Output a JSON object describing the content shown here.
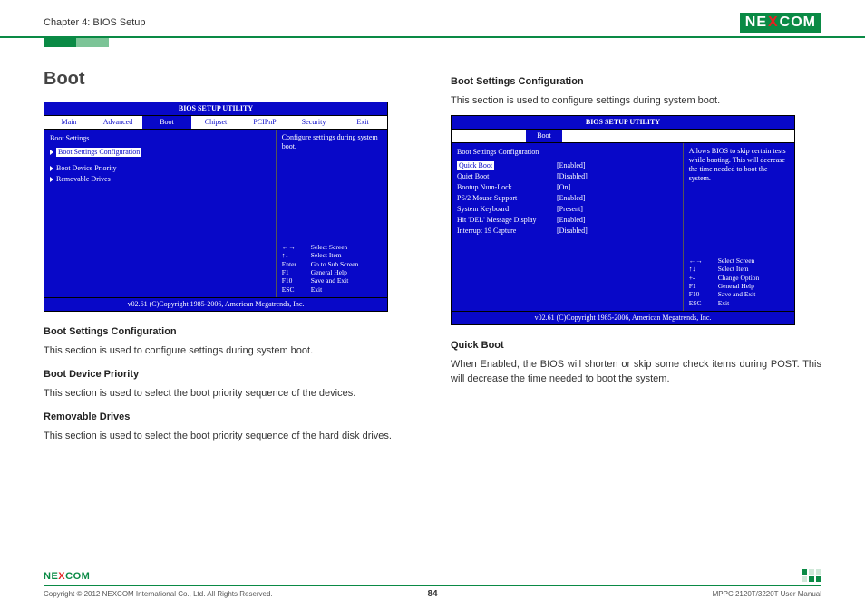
{
  "header": {
    "chapter": "Chapter 4: BIOS Setup",
    "logo_text_1": "NE",
    "logo_x": "X",
    "logo_text_2": "COM"
  },
  "left_col": {
    "h1": "Boot",
    "bios1": {
      "title": "BIOS SETUP UTILITY",
      "tabs": [
        "Main",
        "Advanced",
        "Boot",
        "Chipset",
        "PCIPnP",
        "Security",
        "Exit"
      ],
      "active_tab_index": 2,
      "left_heading": "Boot Settings",
      "items": [
        "Boot Settings Configuration",
        "Boot Device Priority",
        "Removable Drives"
      ],
      "right_top": "Configure settings during system boot.",
      "nav": [
        [
          "←→",
          "Select Screen"
        ],
        [
          "↑↓",
          "Select Item"
        ],
        [
          "Enter",
          "Go to Sub Screen"
        ],
        [
          "F1",
          "General Help"
        ],
        [
          "F10",
          "Save and Exit"
        ],
        [
          "ESC",
          "Exit"
        ]
      ],
      "footer": "v02.61 (C)Copyright 1985-2006, American Megatrends, Inc."
    },
    "sections": [
      {
        "h": "Boot Settings Configuration",
        "p": "This section is used to configure settings during system boot."
      },
      {
        "h": "Boot Device Priority",
        "p": "This section is used to select the boot priority sequence of the devices."
      },
      {
        "h": "Removable Drives",
        "p": "This section is used to select the boot priority sequence of the hard disk drives."
      }
    ]
  },
  "right_col": {
    "top_h": "Boot Settings Configuration",
    "top_p": "This section is used to configure settings during system boot.",
    "bios2": {
      "title": "BIOS SETUP UTILITY",
      "tab": "Boot",
      "left_heading": "Boot Settings Configuration",
      "settings": [
        {
          "label": "Quick Boot",
          "value": "[Enabled]",
          "selected": true
        },
        {
          "label": "Quiet Boot",
          "value": "[Disabled]"
        },
        {
          "label": "Bootup Num-Lock",
          "value": "[On]"
        },
        {
          "label": "PS/2 Mouse Support",
          "value": "[Enabled]"
        },
        {
          "label": "System Keyboard",
          "value": "[Present]"
        },
        {
          "label": "Hit 'DEL' Message Display",
          "value": "[Enabled]"
        },
        {
          "label": "Interrupt 19 Capture",
          "value": "[Disabled]"
        }
      ],
      "right_top": "Allows BIOS to skip certain tests while booting. This will decrease the time needed to boot the system.",
      "nav": [
        [
          "←→",
          "Select Screen"
        ],
        [
          "↑↓",
          "Select Item"
        ],
        [
          "+-",
          "Change Option"
        ],
        [
          "F1",
          "General Help"
        ],
        [
          "F10",
          "Save and Exit"
        ],
        [
          "ESC",
          "Exit"
        ]
      ],
      "footer": "v02.61 (C)Copyright 1985-2006, American Megatrends, Inc."
    },
    "quick_boot_h": "Quick Boot",
    "quick_boot_p": "When Enabled, the BIOS will shorten or skip some check items during POST. This will decrease the time needed to boot the system."
  },
  "footer": {
    "copyright": "Copyright © 2012 NEXCOM International Co., Ltd. All Rights Reserved.",
    "page": "84",
    "manual": "MPPC 2120T/3220T User Manual",
    "logo_text_1": "NE",
    "logo_x": "X",
    "logo_text_2": "COM"
  }
}
